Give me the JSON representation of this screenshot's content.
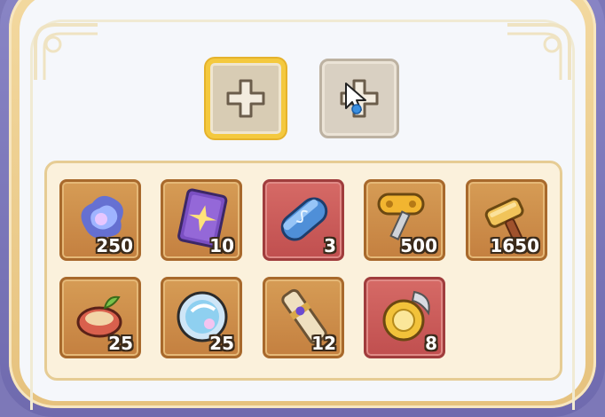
{
  "tabs": [
    {
      "icon": "plus-icon",
      "state": "active"
    },
    {
      "icon": "plus-icon",
      "state": "inactive"
    }
  ],
  "items": [
    {
      "icon": "spirit-crystal-icon",
      "qty": "250",
      "rarity": "gold"
    },
    {
      "icon": "star-card-icon",
      "qty": "10",
      "rarity": "gold"
    },
    {
      "icon": "capsule-icon",
      "qty": "3",
      "rarity": "red"
    },
    {
      "icon": "windup-key-icon",
      "qty": "500",
      "rarity": "gold"
    },
    {
      "icon": "hammer-icon",
      "qty": "1650",
      "rarity": "gold"
    },
    {
      "icon": "seed-pouch-icon",
      "qty": "25",
      "rarity": "gold"
    },
    {
      "icon": "crystal-orb-icon",
      "qty": "25",
      "rarity": "gold"
    },
    {
      "icon": "scroll-staff-icon",
      "qty": "12",
      "rarity": "gold"
    },
    {
      "icon": "golden-medal-icon",
      "qty": "8",
      "rarity": "red"
    }
  ],
  "colors": {
    "gold_slot": "#c98848",
    "red_slot": "#c85a58",
    "active_border": "#f4c93e",
    "frame_purple": "#7d78b8"
  }
}
